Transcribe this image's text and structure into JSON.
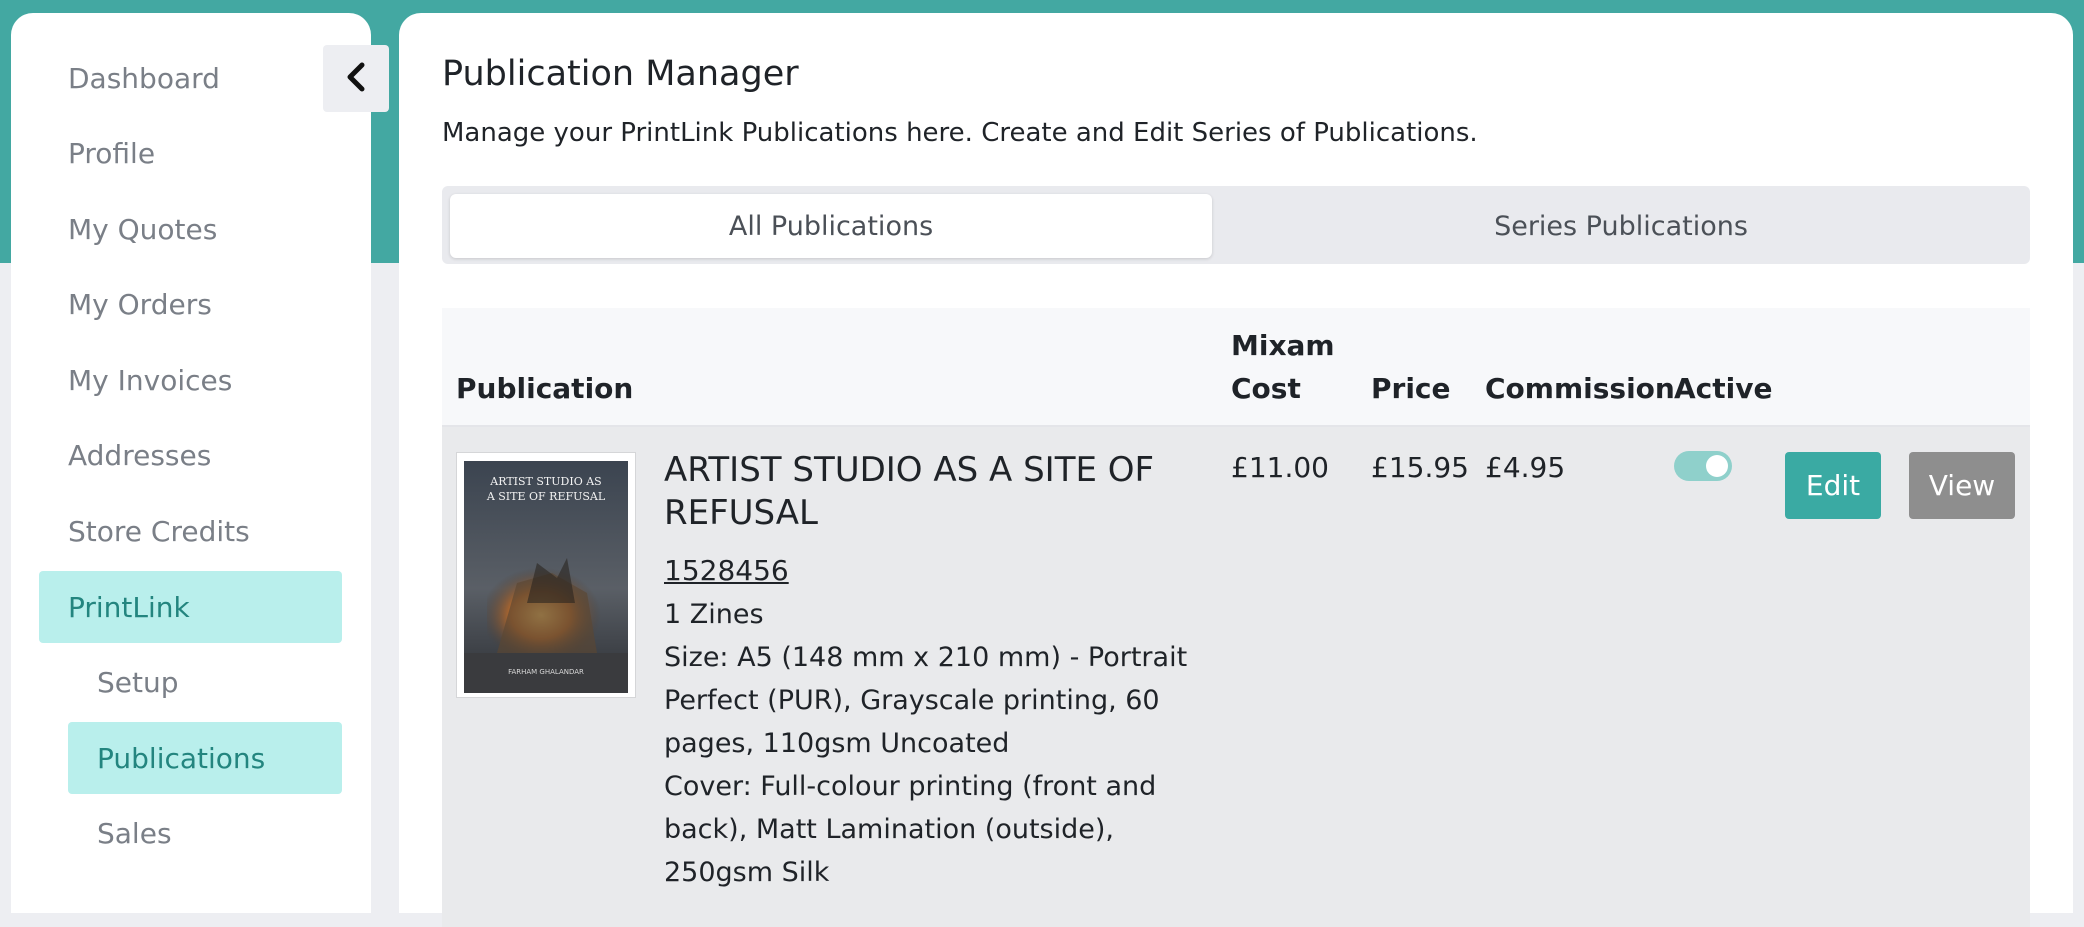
{
  "colors": {
    "teal": "#43a8a2",
    "active_bg": "#b9efec",
    "active_text": "#23857f",
    "edit_button": "#3aaaa3",
    "view_button": "#8e8e8e"
  },
  "sidebar": {
    "collapse_icon": "chevron-left-icon",
    "items": [
      {
        "label": "Dashboard"
      },
      {
        "label": "Profile"
      },
      {
        "label": "My Quotes"
      },
      {
        "label": "My Orders"
      },
      {
        "label": "My Invoices"
      },
      {
        "label": "Addresses"
      },
      {
        "label": "Store Credits"
      },
      {
        "label": "PrintLink",
        "active": true
      },
      {
        "label": "Setup",
        "sub": true
      },
      {
        "label": "Publications",
        "sub": true,
        "active": true
      },
      {
        "label": "Sales",
        "sub": true
      }
    ]
  },
  "main": {
    "title": "Publication Manager",
    "subtitle": "Manage your PrintLink Publications here. Create and Edit Series of Publications.",
    "tabs": [
      {
        "label": "All Publications",
        "active": true
      },
      {
        "label": "Series Publications",
        "active": false
      }
    ],
    "table": {
      "headers": {
        "publication": "Publication",
        "mixam_cost_line1": "Mixam",
        "mixam_cost_line2": "Cost",
        "price": "Price",
        "commission": "Commission",
        "active": "Active"
      },
      "rows": [
        {
          "cover_title": "ARTIST STUDIO AS A SITE OF REFUSAL",
          "cover_author": "FARHAM GHALANDAR",
          "title": "ARTIST STUDIO AS A SITE OF REFUSAL",
          "id": "1528456",
          "quantity": "1 Zines",
          "size": "Size: A5 (148 mm x 210 mm) - Portrait",
          "binding": "Perfect (PUR), Grayscale printing, 60 pages, 110gsm Uncoated",
          "cover": "Cover: Full-colour printing (front and back), Matt Lamination (outside), 250gsm Silk",
          "mixam_cost": "£11.00",
          "price": "£15.95",
          "commission": "£4.95",
          "active": true,
          "edit_label": "Edit",
          "view_label": "View"
        }
      ]
    }
  }
}
